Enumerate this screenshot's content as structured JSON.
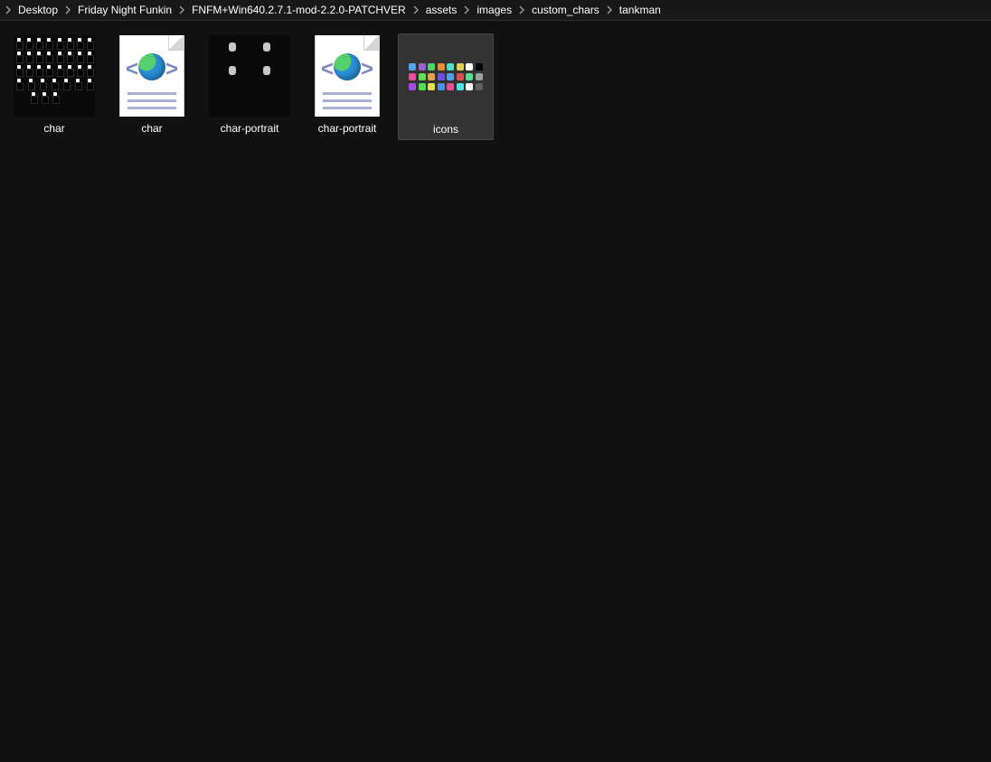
{
  "breadcrumb": [
    "Desktop",
    "Friday Night Funkin",
    "FNFM+Win640.2.7.1-mod-2.2.0-PATCHVER",
    "assets",
    "images",
    "custom_chars",
    "tankman"
  ],
  "files": [
    {
      "name": "char",
      "kind": "spritesheet",
      "selected": false
    },
    {
      "name": "char",
      "kind": "xml",
      "selected": false
    },
    {
      "name": "char-portrait",
      "kind": "portrait",
      "selected": false
    },
    {
      "name": "char-portrait",
      "kind": "xml",
      "selected": false
    },
    {
      "name": "icons",
      "kind": "iconsgrid",
      "selected": true
    }
  ],
  "iconsgrid_colors": [
    [
      "#52a3e6",
      "#9a61d4",
      "#4bd46a",
      "#e09030",
      "#4fe0c8",
      "#e0d24f",
      "#ffffff",
      "#000000"
    ],
    [
      "#e64fa0",
      "#5fe04f",
      "#e0a24f",
      "#6f4fe0",
      "#4fa0e6",
      "#e04f4f",
      "#4fe090",
      "#a0a0a0"
    ],
    [
      "#a04fe6",
      "#4fe04f",
      "#e6e04f",
      "#4f90e6",
      "#e64f90",
      "#4fe6e6",
      "#ffffff",
      "#606060"
    ]
  ]
}
